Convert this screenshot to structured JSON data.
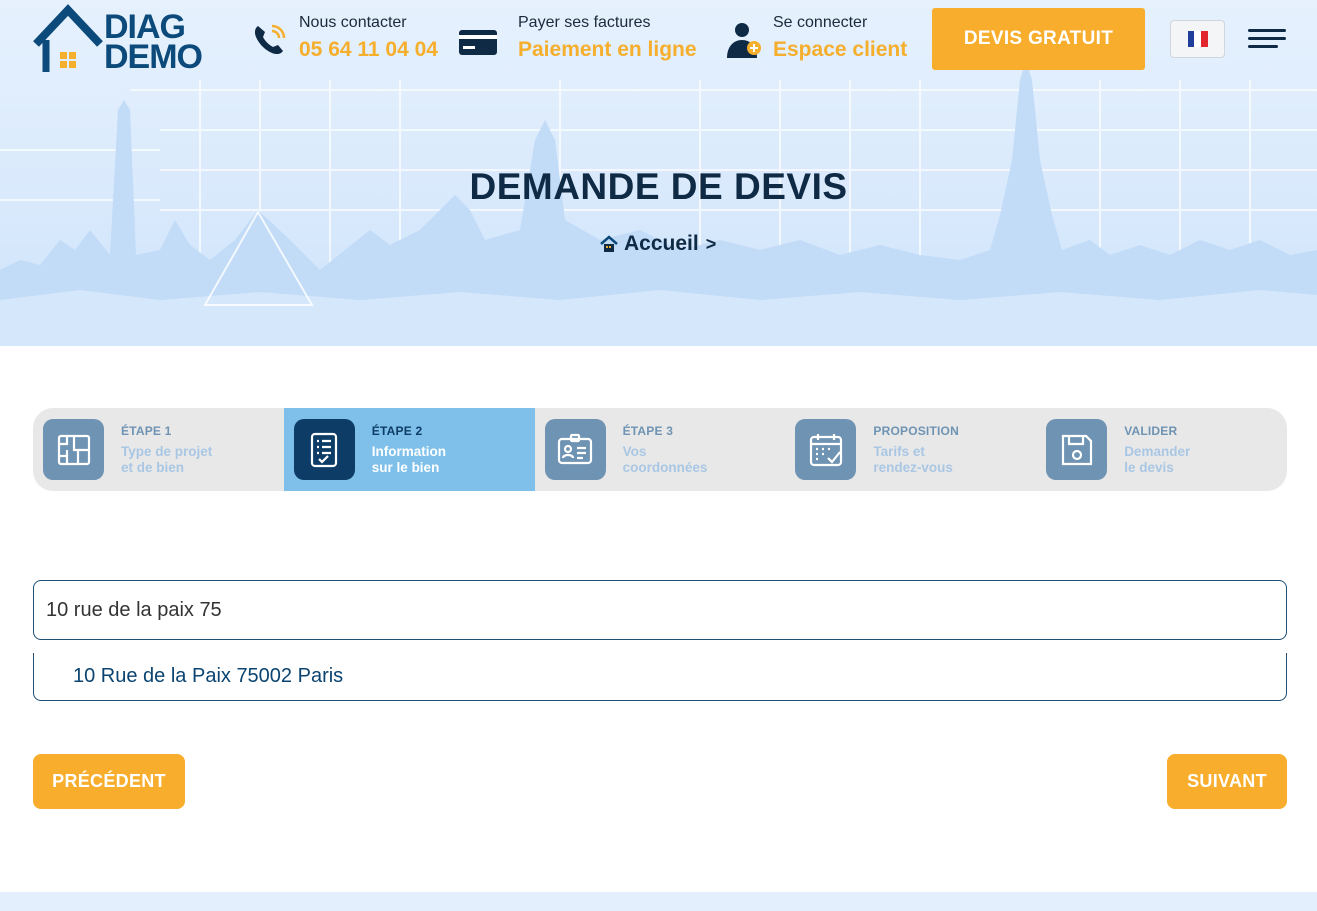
{
  "header": {
    "logo": {
      "line1": "DIAG",
      "line2": "DEMO"
    },
    "contact": {
      "label": "Nous contacter",
      "value": "05 64 11 04 04"
    },
    "payment": {
      "label": "Payer ses factures",
      "value": "Paiement en ligne"
    },
    "account": {
      "label": "Se connecter",
      "value": "Espace client"
    },
    "cta_label": "DEVIS GRATUIT",
    "language_icon": "flag-fr-icon",
    "menu_icon": "hamburger-menu-icon"
  },
  "hero": {
    "title": "DEMANDE DE DEVIS",
    "breadcrumb": {
      "home_label": "Accueil",
      "separator": ">"
    }
  },
  "stepper": {
    "steps": [
      {
        "title": "ÉTAPE 1",
        "line1": "Type de projet",
        "line2": "et de bien",
        "icon": "blueprint-icon",
        "active": false
      },
      {
        "title": "ÉTAPE 2",
        "line1": "Information",
        "line2": "sur le bien",
        "icon": "checklist-icon",
        "active": true
      },
      {
        "title": "ÉTAPE 3",
        "line1": "Vos",
        "line2": "coordonnées",
        "icon": "id-card-icon",
        "active": false
      },
      {
        "title": "PROPOSITION",
        "line1": "Tarifs et",
        "line2": "rendez-vous",
        "icon": "calendar-check-icon",
        "active": false
      },
      {
        "title": "VALIDER",
        "line1": "Demander",
        "line2": "le devis",
        "icon": "save-icon",
        "active": false
      }
    ]
  },
  "form": {
    "address_value": "10 rue de la paix 75",
    "suggestion": "10 Rue de la Paix 75002 Paris",
    "prev_label": "PRÉCÉDENT",
    "next_label": "SUIVANT"
  },
  "colors": {
    "accent": "#f8ae2c",
    "navy": "#0f2a44",
    "active_step": "#7ec0ea",
    "step_icon": "#6f93b3"
  }
}
